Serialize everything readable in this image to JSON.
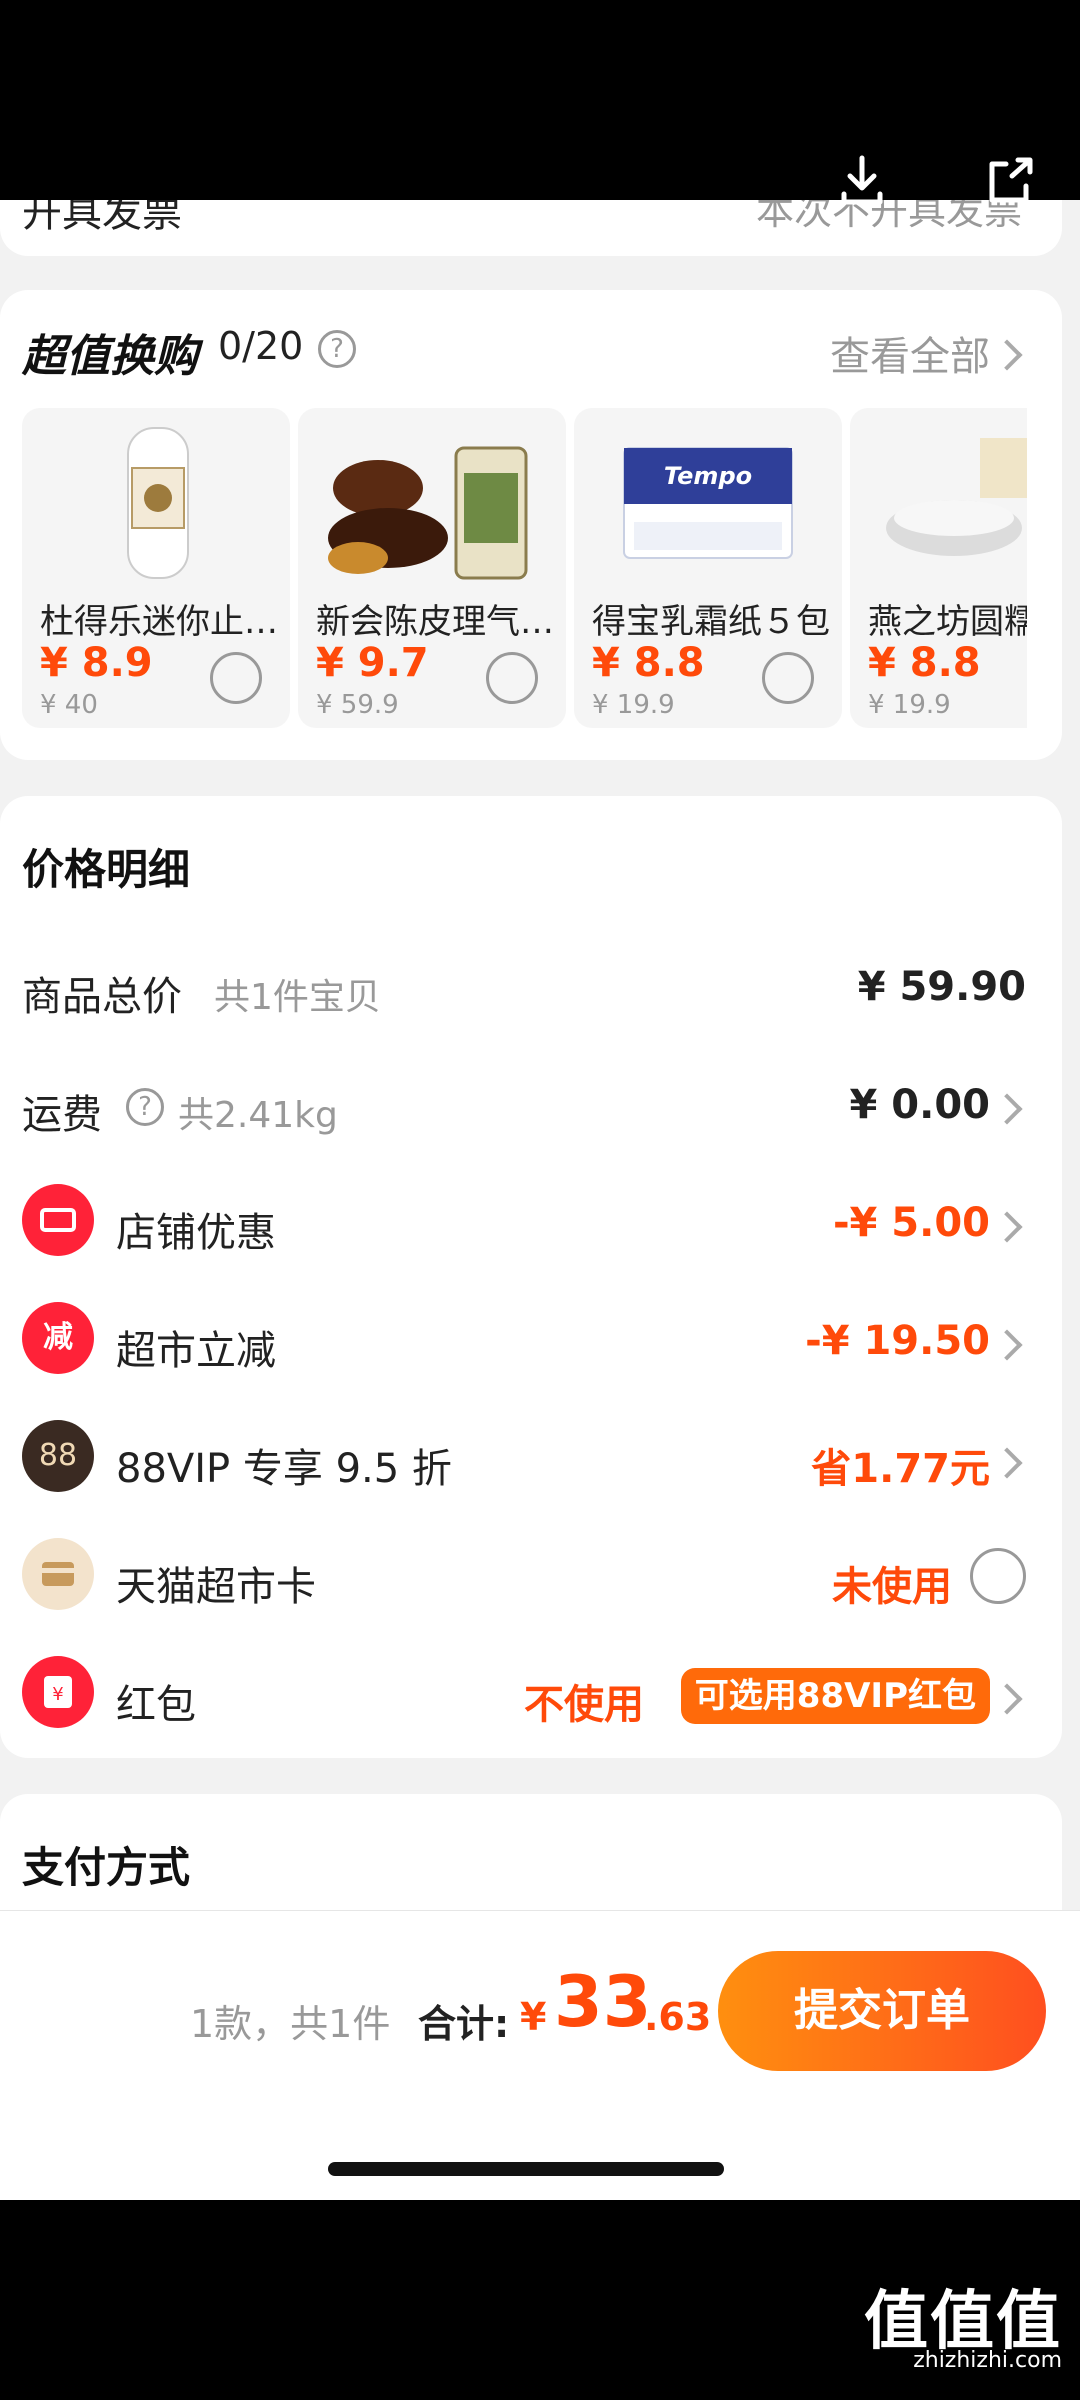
{
  "top_icons": [
    "download-icon",
    "share-icon"
  ],
  "invoice": {
    "label": "开具发票",
    "value": "本次不开具发票"
  },
  "swap": {
    "title": "超值换购",
    "count": "0/20",
    "help": "?",
    "view_all": "查看全部",
    "products": [
      {
        "name": "杜得乐迷你止…",
        "price": "¥ 8.9",
        "original": "¥ 40"
      },
      {
        "name": "新会陈皮理气…",
        "price": "¥ 9.7",
        "original": "¥ 59.9"
      },
      {
        "name": "得宝乳霜纸５包",
        "price": "¥ 8.8",
        "original": "¥ 19.9"
      },
      {
        "name": "燕之坊圆糯",
        "price": "¥ 8.8",
        "original": "¥ 19.9"
      }
    ]
  },
  "price": {
    "title": "价格明细",
    "goods": {
      "label": "商品总价",
      "sub": "共1件宝贝",
      "value": "¥ 59.90"
    },
    "shipping": {
      "label": "运费",
      "help": "?",
      "sub": "共2.41kg",
      "value": "¥ 0.00"
    },
    "store": {
      "icon_text": "",
      "label": "店铺优惠",
      "value": "-¥ 5.00"
    },
    "market": {
      "icon_text": "减",
      "label": "超市立减",
      "value": "-¥ 19.50"
    },
    "vip": {
      "icon_text": "88",
      "label": "88VIP 专享 9.5 折",
      "value": "省1.77元"
    },
    "card": {
      "label": "天猫超市卡",
      "value": "未使用"
    },
    "redpack": {
      "icon_text": "¥",
      "label": "红包",
      "value": "不使用",
      "tag": "可选用88VIP红包"
    }
  },
  "payment": {
    "title": "支付方式"
  },
  "bottom": {
    "count": "1款，共1件",
    "total_label": "合计:",
    "currency": "¥",
    "amount_int": "33",
    "amount_dec": ".63",
    "submit": "提交订单"
  },
  "watermark": {
    "text": "值值值",
    "url": "zhizhizhi.com"
  },
  "colors": {
    "accent": "#ff4a0a",
    "orange": "#ff6a0a",
    "background": "#f2f2f2"
  }
}
